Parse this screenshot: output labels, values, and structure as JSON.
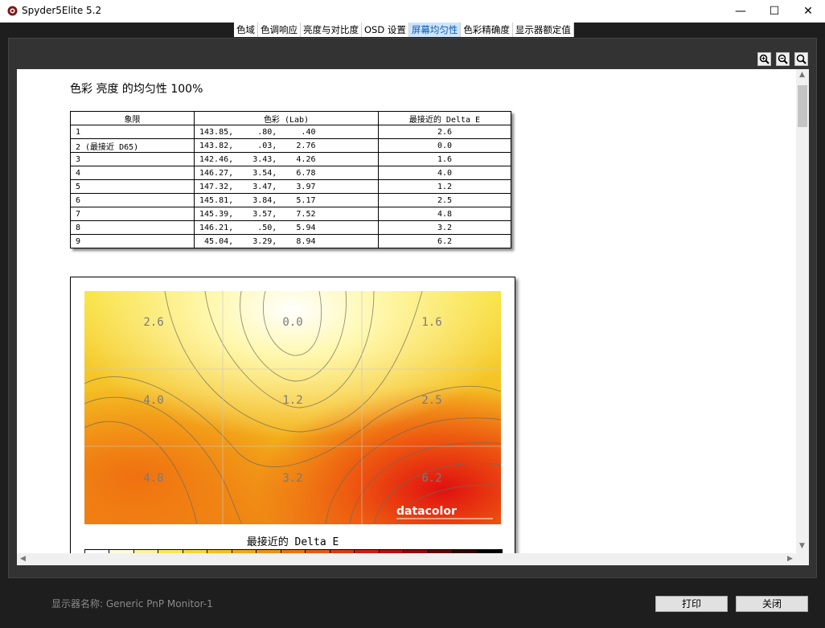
{
  "window": {
    "title": "Spyder5Elite 5.2"
  },
  "tabs": [
    {
      "label": "色域"
    },
    {
      "label": "色调响应"
    },
    {
      "label": "亮度与对比度"
    },
    {
      "label": "OSD 设置"
    },
    {
      "label": "屏幕均匀性",
      "active": true
    },
    {
      "label": "色彩精确度"
    },
    {
      "label": "显示器额定值"
    }
  ],
  "report": {
    "title": "色彩 亮度 的均匀性 100%",
    "table": {
      "headers": [
        "象限",
        "色彩 (Lab)",
        "最接近的 Delta E"
      ],
      "rows": [
        [
          "1",
          "143.85,     .80,     .40",
          "2.6"
        ],
        [
          "2 (最接近 D65)",
          "143.82,     .03,    2.76",
          "0.0"
        ],
        [
          "3",
          "142.46,    3.43,    4.26",
          "1.6"
        ],
        [
          "4",
          "146.27,    3.54,    6.78",
          "4.0"
        ],
        [
          "5",
          "147.32,    3.47,    3.97",
          "1.2"
        ],
        [
          "6",
          "145.81,    3.84,    5.17",
          "2.5"
        ],
        [
          "7",
          "145.39,    3.57,    7.52",
          "4.8"
        ],
        [
          "8",
          "146.21,     .50,    5.94",
          "3.2"
        ],
        [
          "9",
          " 45.04,    3.29,    8.94",
          "6.2"
        ]
      ]
    },
    "map": {
      "cells": [
        "2.6",
        "0.0",
        "1.6",
        "4.0",
        "1.2",
        "2.5",
        "4.8",
        "3.2",
        "6.2"
      ],
      "brand": "datacolor",
      "legend_title": "最接近的 Delta E"
    }
  },
  "footer": {
    "monitor_label": "显示器名称: Generic PnP Monitor-1",
    "print_label": "打印",
    "close_label": "关闭"
  }
}
